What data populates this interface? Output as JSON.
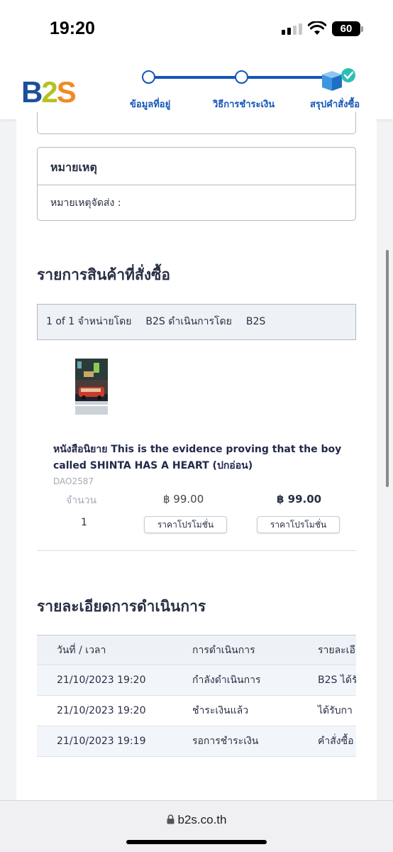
{
  "status_bar": {
    "time": "19:20",
    "battery": "60"
  },
  "header": {
    "logo": {
      "b": "B",
      "n2": "2",
      "s": "S"
    },
    "steps": [
      {
        "label": "ข้อมูลที่อยู่"
      },
      {
        "label": "วิธีการชำระเงิน"
      },
      {
        "label": "สรุปคำสั่งซื้อ"
      }
    ]
  },
  "note": {
    "title": "หมายเหตุ",
    "line": "หมายเหตุจัดส่ง :"
  },
  "order_items": {
    "title": "รายการสินค้าที่สั่งซื้อ",
    "seller_bar": {
      "count": "1 of 1",
      "sold_by_label": "จำหน่ายโดย",
      "sold_by": "B2S",
      "operated_by_label": "ดำเนินการโดย",
      "operated_by": "B2S"
    },
    "item": {
      "name": "หนังสือนิยาย This is the evidence proving that the boy called SHINTA HAS A HEART (ปกอ่อน)",
      "sku": "DAO2587",
      "qty_label": "จำนวน",
      "qty": "1",
      "price": "฿ 99.00",
      "total": "฿ 99.00",
      "promo_label": "ราคาโปรโมชั่น"
    }
  },
  "operations": {
    "title": "รายละเอียดการดำเนินการ",
    "columns": [
      "วันที่ / เวลา",
      "การดำเนินการ",
      "รายละเอี"
    ],
    "rows": [
      [
        "21/10/2023 19:20",
        "กำลังดำเนินการ",
        "B2S ได้รั"
      ],
      [
        "21/10/2023 19:20",
        "ชำระเงินแล้ว",
        "ได้รับกา"
      ],
      [
        "21/10/2023 19:19",
        "รอการชำระเงิน",
        "คำสั่งซื้อ"
      ]
    ]
  },
  "browser": {
    "url": "b2s.co.th"
  },
  "colors": {
    "accent": "#1456b8",
    "logo_blue": "#1c4f9a",
    "logo_green": "#b4c21f",
    "logo_orange": "#f08a24",
    "check": "#2dbfb5"
  }
}
